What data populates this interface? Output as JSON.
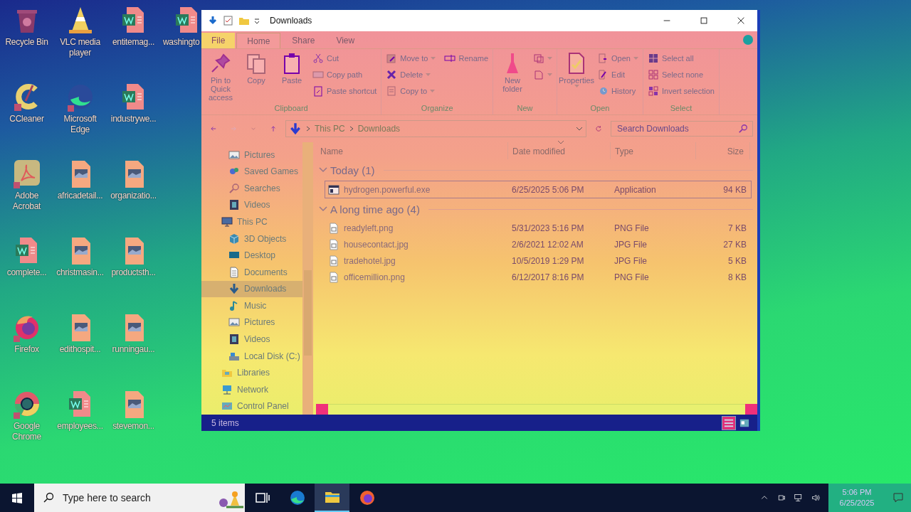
{
  "desktop": {
    "columns": [
      [
        {
          "label": "Recycle Bin",
          "kind": "recycle"
        },
        {
          "label": "CCleaner",
          "kind": "ccleaner"
        },
        {
          "label": "Adobe Acrobat",
          "kind": "acrobat"
        },
        {
          "label": "complete...",
          "kind": "word"
        },
        {
          "label": "Firefox",
          "kind": "firefox"
        },
        {
          "label": "Google Chrome",
          "kind": "chrome"
        }
      ],
      [
        {
          "label": "VLC media player",
          "kind": "vlc"
        },
        {
          "label": "Microsoft Edge",
          "kind": "edge"
        },
        {
          "label": "africadetail...",
          "kind": "image"
        },
        {
          "label": "christmasin...",
          "kind": "image"
        },
        {
          "label": "edithospit...",
          "kind": "image"
        },
        {
          "label": "employees...",
          "kind": "word"
        }
      ],
      [
        {
          "label": "entitemag...",
          "kind": "word"
        },
        {
          "label": "industrywe...",
          "kind": "word"
        },
        {
          "label": "organizatio...",
          "kind": "image"
        },
        {
          "label": "productsth...",
          "kind": "image"
        },
        {
          "label": "runningau...",
          "kind": "image"
        },
        {
          "label": "stevemon...",
          "kind": "image"
        }
      ],
      [
        {
          "label": "washingto",
          "kind": "word"
        }
      ]
    ]
  },
  "window": {
    "title": "Downloads",
    "tabs": [
      {
        "label": "File",
        "kind": "file",
        "selected": false
      },
      {
        "label": "Home",
        "kind": "tab",
        "selected": true
      },
      {
        "label": "Share",
        "kind": "tab",
        "selected": false
      },
      {
        "label": "View",
        "kind": "tab",
        "selected": false
      }
    ],
    "groups": [
      {
        "label": "Clipboard",
        "large": [
          {
            "label": "Pin to Quick access",
            "kind": "pin"
          },
          {
            "label": "Copy",
            "kind": "copy"
          },
          {
            "label": "Paste",
            "kind": "paste"
          }
        ],
        "small": [
          {
            "label": "Cut",
            "kind": "cut"
          },
          {
            "label": "Copy path",
            "kind": "path"
          },
          {
            "label": "Paste shortcut",
            "kind": "shortcut"
          }
        ]
      },
      {
        "label": "Organize",
        "small": [
          {
            "label": "Move to",
            "kind": "move",
            "dropdown": true
          },
          {
            "label": "Delete",
            "kind": "delete",
            "dropdown": true
          },
          {
            "label": "Copy to",
            "kind": "copyto",
            "dropdown": true
          },
          {
            "label": "Rename",
            "kind": "rename"
          }
        ]
      },
      {
        "label": "New",
        "large": [
          {
            "label": "New folder",
            "kind": "folder"
          }
        ],
        "small": [
          {
            "kind": "newitem",
            "dropdown": true
          },
          {
            "kind": "easy",
            "dropdown": true
          }
        ]
      },
      {
        "label": "Open",
        "large": [
          {
            "label": "Properties",
            "kind": "properties",
            "dropdown": true
          }
        ],
        "small": [
          {
            "label": "Open",
            "kind": "open",
            "dropdown": true
          },
          {
            "label": "Edit",
            "kind": "edit"
          },
          {
            "label": "History",
            "kind": "history"
          }
        ]
      },
      {
        "label": "Select",
        "small": [
          {
            "label": "Select all",
            "kind": "selall"
          },
          {
            "label": "Select none",
            "kind": "selnone"
          },
          {
            "label": "Invert selection",
            "kind": "invert"
          }
        ]
      }
    ],
    "path": [
      "This PC",
      "Downloads"
    ],
    "search": {
      "placeholder": "Search Downloads"
    },
    "nav": {
      "partial": [
        {
          "label": "Pictures",
          "kind": "pictures",
          "selected": false
        },
        {
          "label": "Saved Games",
          "kind": "games",
          "selected": false
        },
        {
          "label": "Searches",
          "kind": "searches",
          "selected": false
        },
        {
          "label": "Videos",
          "kind": "videos",
          "selected": false
        }
      ],
      "items": [
        {
          "label": "This PC",
          "kind": "pc",
          "selected": false,
          "children": [
            {
              "label": "3D Objects",
              "kind": "objects",
              "selected": false
            },
            {
              "label": "Desktop",
              "kind": "desktop",
              "selected": false
            },
            {
              "label": "Documents",
              "kind": "documents",
              "selected": false
            },
            {
              "label": "Downloads",
              "kind": "downloads",
              "selected": true
            },
            {
              "label": "Music",
              "kind": "music",
              "selected": false
            },
            {
              "label": "Pictures",
              "kind": "pictures",
              "selected": false
            },
            {
              "label": "Videos",
              "kind": "videos",
              "selected": false
            },
            {
              "label": "Local Disk (C:)",
              "kind": "disk",
              "selected": false
            }
          ]
        },
        {
          "label": "Libraries",
          "kind": "libraries",
          "selected": false
        },
        {
          "label": "Network",
          "kind": "network",
          "selected": false
        },
        {
          "label": "Control Panel",
          "kind": "control",
          "selected": false
        }
      ]
    },
    "columns": [
      {
        "label": "Name",
        "sorted": false
      },
      {
        "label": "Date modified",
        "sorted": true
      },
      {
        "label": "Type",
        "sorted": false
      },
      {
        "label": "Size",
        "sorted": false
      }
    ],
    "groups_list": [
      {
        "label": "Today (1)",
        "expanded": true,
        "rows": [
          {
            "name": "hydrogen.powerful.exe",
            "kind": "app",
            "date": "6/25/2025 5:06 PM",
            "type": "Application",
            "size": "94 KB",
            "focused": true
          }
        ]
      },
      {
        "label": "A long time ago (4)",
        "expanded": true,
        "rows": [
          {
            "name": "readyleft.png",
            "kind": "file",
            "date": "5/31/2023 5:16 PM",
            "type": "PNG File",
            "size": "7 KB",
            "focused": false
          },
          {
            "name": "housecontact.jpg",
            "kind": "file",
            "date": "2/6/2021 12:02 AM",
            "type": "JPG File",
            "size": "27 KB",
            "focused": false
          },
          {
            "name": "tradehotel.jpg",
            "kind": "file",
            "date": "10/5/2019 1:29 PM",
            "type": "JPG File",
            "size": "5 KB",
            "focused": false
          },
          {
            "name": "officemillion.png",
            "kind": "file",
            "date": "6/12/2017 8:16 PM",
            "type": "PNG File",
            "size": "8 KB",
            "focused": false
          }
        ]
      }
    ],
    "status": "5 items",
    "views": [
      {
        "kind": "details",
        "selected": true
      },
      {
        "kind": "tiles",
        "selected": false
      }
    ]
  },
  "taskbar": {
    "search": {
      "placeholder": "Type here to search"
    },
    "apps": [
      {
        "kind": "taskview",
        "active": false
      },
      {
        "kind": "edge",
        "active": false
      },
      {
        "kind": "explorer",
        "active": true
      },
      {
        "kind": "firefox",
        "active": false
      }
    ],
    "time": "5:06 PM",
    "date": "6/25/2025"
  }
}
